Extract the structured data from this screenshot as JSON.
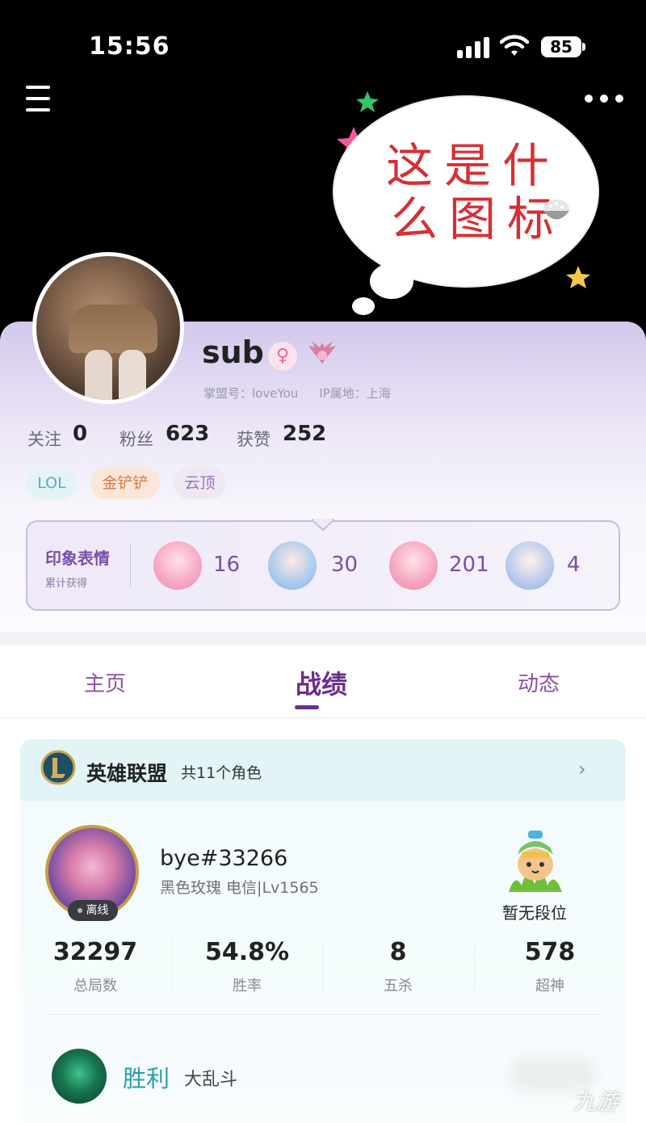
{
  "status_bar": {
    "time": "15:56",
    "battery": "85"
  },
  "banner": {
    "line1": "这是什",
    "line2": "么图标"
  },
  "profile": {
    "username": "sub",
    "gender_symbol": "♀",
    "id_label": "掌盟号：loveYou",
    "ip_label": "IP属地：上海",
    "stats": [
      {
        "label": "关注",
        "value": "0"
      },
      {
        "label": "粉丝",
        "value": "623"
      },
      {
        "label": "获赞",
        "value": "252"
      }
    ],
    "tags": [
      "LOL",
      "金铲铲",
      "云顶"
    ]
  },
  "impression": {
    "title": "印象表情",
    "subtitle": "累计获得",
    "counts": [
      "16",
      "30",
      "201",
      "4"
    ]
  },
  "tabs": [
    "主页",
    "战绩",
    "动态"
  ],
  "game": {
    "name": "英雄联盟",
    "roles": "共11个角色",
    "chevron": "›",
    "player_id": "bye#33266",
    "server": "黑色玫瑰 电信|Lv1565",
    "status": "离线",
    "rank": "暂无段位",
    "stats": [
      {
        "value": "32297",
        "label": "总局数"
      },
      {
        "value": "54.8%",
        "label": "胜率"
      },
      {
        "value": "8",
        "label": "五杀"
      },
      {
        "value": "578",
        "label": "超神"
      }
    ],
    "last_match": {
      "result": "胜利",
      "mode": "大乱斗"
    }
  },
  "watermark": "九游"
}
